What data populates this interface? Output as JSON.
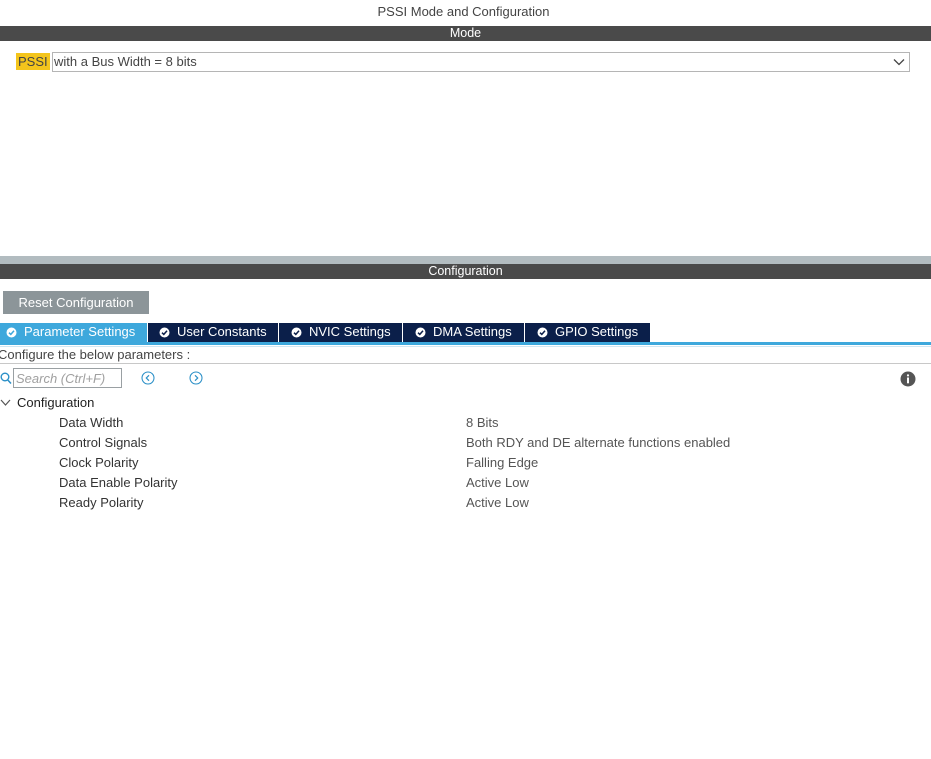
{
  "window": {
    "title": "PSSI Mode and Configuration"
  },
  "mode_section": {
    "header": "Mode",
    "label": "PSSI",
    "selected_value": "with a Bus Width = 8 bits"
  },
  "config_section": {
    "header": "Configuration",
    "reset_button": "Reset Configuration",
    "tabs": [
      {
        "label": "Parameter Settings",
        "active": true
      },
      {
        "label": "User Constants",
        "active": false
      },
      {
        "label": "NVIC Settings",
        "active": false
      },
      {
        "label": "DMA Settings",
        "active": false
      },
      {
        "label": "GPIO Settings",
        "active": false
      }
    ],
    "instructions": "Configure the below parameters :",
    "search": {
      "placeholder": "Search (Ctrl+F)",
      "value": ""
    },
    "tree": {
      "group_label": "Configuration",
      "expanded": true,
      "params": [
        {
          "name": "Data Width",
          "value": "8 Bits"
        },
        {
          "name": "Control Signals",
          "value": "Both RDY and DE alternate functions enabled"
        },
        {
          "name": "Clock Polarity",
          "value": "Falling Edge"
        },
        {
          "name": "Data Enable Polarity",
          "value": "Active Low"
        },
        {
          "name": "Ready Polarity",
          "value": "Active Low"
        }
      ]
    }
  },
  "icons": {
    "select_arrow": "chevron-down-icon",
    "tab_status": "check-circle-icon",
    "search": "search-icon",
    "prev": "circle-chevron-left-icon",
    "next": "circle-chevron-right-icon",
    "info": "info-icon",
    "tree_toggle": "chevron-down-icon"
  },
  "colors": {
    "section_header_bg": "#4a4a4a",
    "mode_label_highlight": "#f4c51c",
    "tab_active": "#3ea8dc",
    "tab_inactive": "#0b1f4a",
    "reset_button_bg": "#8c9599",
    "divider": "#b2bcc0"
  }
}
